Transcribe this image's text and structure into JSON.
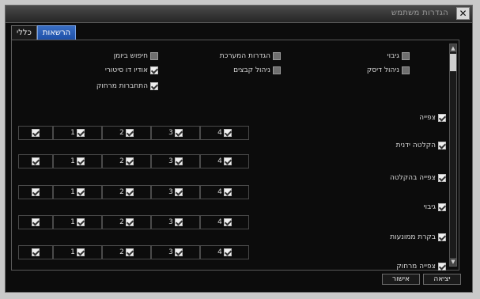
{
  "window": {
    "title": "הגדרות משתמש",
    "close_glyph": "✕"
  },
  "tabs": [
    {
      "label": "כללי"
    },
    {
      "label": "הרשאות"
    }
  ],
  "permissions": {
    "row1": [
      {
        "label": "גיבוי",
        "checked": false
      },
      {
        "label": "הגדרות המערכת",
        "checked": false
      },
      {
        "label": "חיפוש ביומן",
        "checked": false
      }
    ],
    "row2": [
      {
        "label": "ניהול דיסק",
        "checked": false
      },
      {
        "label": "ניהול קבצים",
        "checked": false
      },
      {
        "label": "אודיו דו סיטורי",
        "checked": true
      }
    ],
    "row3": [
      {
        "label": "התחברות מרחוק",
        "checked": true
      }
    ]
  },
  "sections": [
    {
      "label": "צפייה",
      "checked": true,
      "channels": [
        "4",
        "3",
        "2",
        "1"
      ]
    },
    {
      "label": "הקלטה ידנית",
      "checked": true,
      "channels": [
        "4",
        "3",
        "2",
        "1"
      ]
    },
    {
      "label": "צפייה בהקלטה",
      "checked": true,
      "channels": [
        "4",
        "3",
        "2",
        "1"
      ]
    },
    {
      "label": "גיבוי",
      "checked": true,
      "channels": [
        "4",
        "3",
        "2",
        "1"
      ]
    },
    {
      "label": "בקרת ממונעות",
      "checked": true,
      "channels": [
        "4",
        "3",
        "2",
        "1"
      ]
    },
    {
      "label": "צפייה מרחוק",
      "checked": true
    }
  ],
  "footer": {
    "ok_label": "אישור",
    "exit_label": "יציאה"
  }
}
